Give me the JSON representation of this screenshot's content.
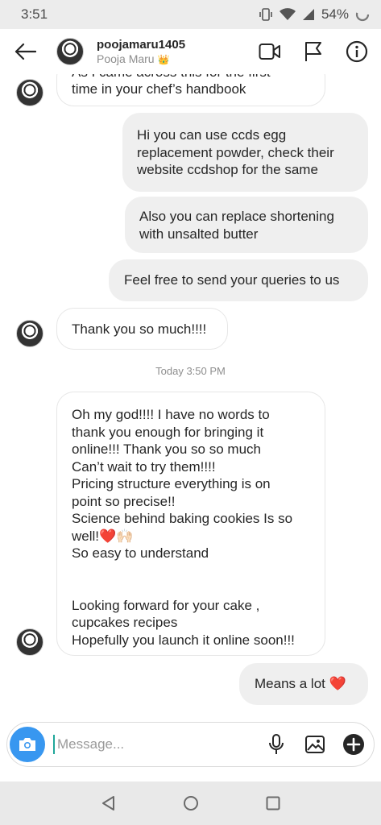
{
  "status_bar": {
    "time": "3:51",
    "battery": "54%"
  },
  "header": {
    "username": "poojamaru1405",
    "real_name": "Pooja Maru",
    "crown_emoji": "👑",
    "icons": [
      "back-arrow-icon",
      "video-call-icon",
      "flag-icon",
      "info-icon"
    ]
  },
  "messages": [
    {
      "direction": "in",
      "text": "As I came across this for the first\ntime in your chef’s handbook"
    },
    {
      "direction": "out",
      "text": "Hi you can use ccds egg\nreplacement powder, check their\nwebsite ccdshop for the same"
    },
    {
      "direction": "out",
      "text": "Also you can replace shortening\nwith unsalted butter"
    },
    {
      "direction": "out",
      "text": "Feel free to send your queries to us"
    },
    {
      "direction": "in",
      "text": "Thank you so much!!!!"
    },
    {
      "direction": "in",
      "text": "Oh my god!!!! I have no words to\nthank you enough for bringing it\nonline!!! Thank you  so so much\nCan’t wait to try them!!!!\nPricing structure everything is on\npoint so precise!!\nScience behind baking cookies Is so\nwell!❤️🙌🏻\nSo easy to understand\n\n\nLooking forward for your cake ,\ncupcakes recipes\nHopefully you launch it online soon!!!"
    },
    {
      "direction": "out",
      "text": "Means a lot ❤️"
    }
  ],
  "timestamp": "Today 3:50 PM",
  "composer": {
    "placeholder": "Message...",
    "icons": [
      "camera-icon",
      "microphone-icon",
      "gallery-icon",
      "add-icon"
    ]
  },
  "nav_bar": {
    "icons": [
      "back-triangle-icon",
      "home-circle-icon",
      "recents-square-icon"
    ]
  },
  "colors": {
    "accent": "#3897f0",
    "outgoing_bubble": "#efefef",
    "incoming_border": "#e6e6e6",
    "heart": "#e0245e"
  }
}
